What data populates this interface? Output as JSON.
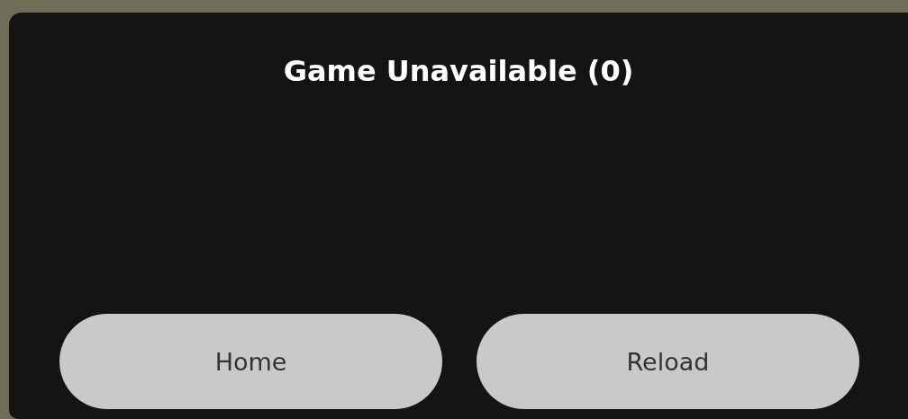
{
  "dialog": {
    "title": "Game Unavailable (0)",
    "buttons": [
      {
        "label": "Home"
      },
      {
        "label": "Reload"
      }
    ]
  }
}
